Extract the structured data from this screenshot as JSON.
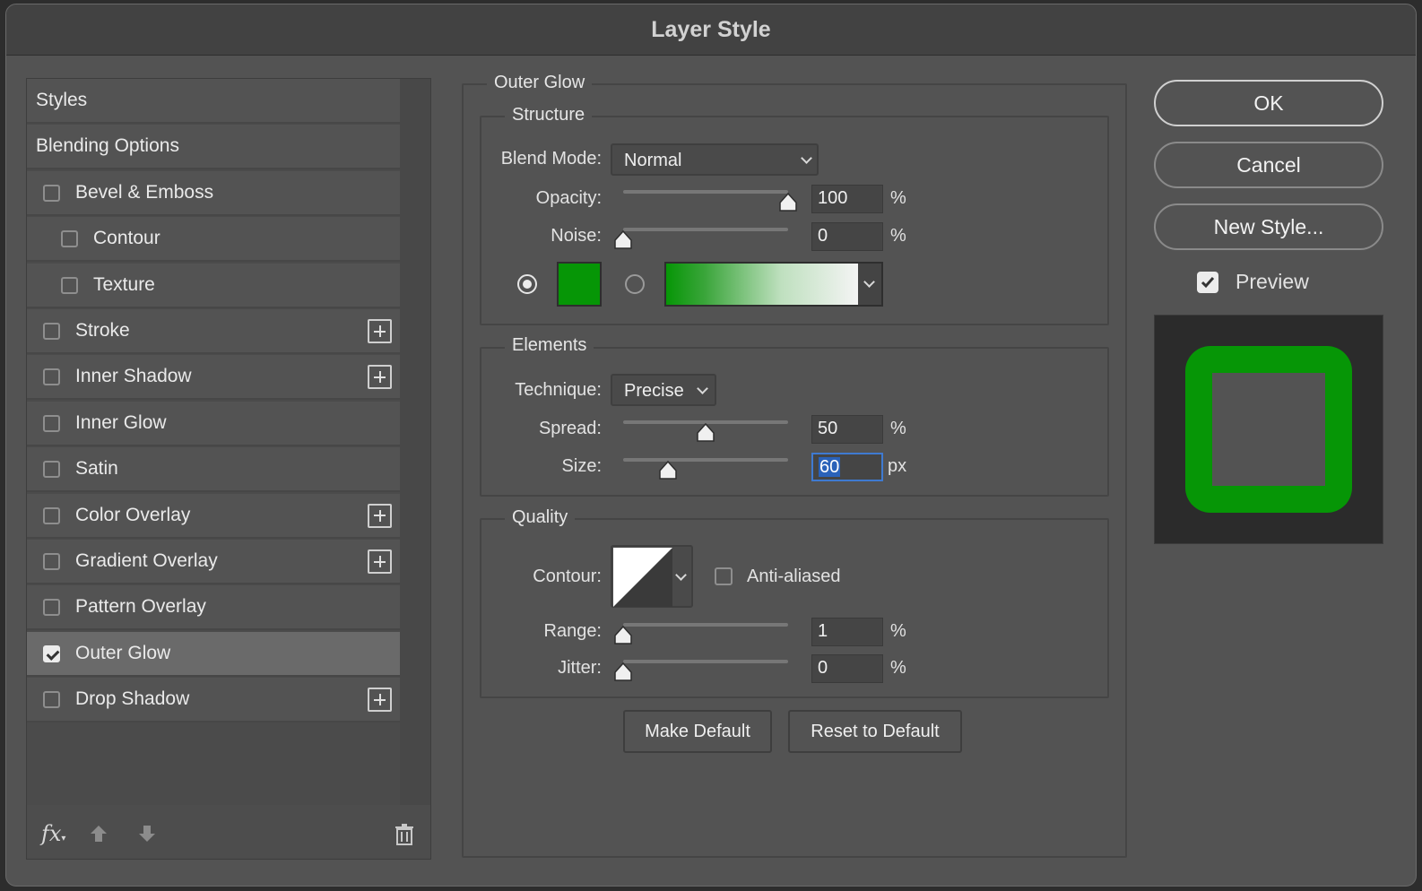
{
  "dialog": {
    "title": "Layer Style"
  },
  "style_list": {
    "items": [
      {
        "label": "Styles",
        "checkbox": false,
        "checked": false,
        "plus": false,
        "indent": 0,
        "selected": false
      },
      {
        "label": "Blending Options",
        "checkbox": false,
        "checked": false,
        "plus": false,
        "indent": 0,
        "selected": false
      },
      {
        "label": "Bevel & Emboss",
        "checkbox": true,
        "checked": false,
        "plus": false,
        "indent": 0,
        "selected": false
      },
      {
        "label": "Contour",
        "checkbox": true,
        "checked": false,
        "plus": false,
        "indent": 1,
        "selected": false
      },
      {
        "label": "Texture",
        "checkbox": true,
        "checked": false,
        "plus": false,
        "indent": 1,
        "selected": false
      },
      {
        "label": "Stroke",
        "checkbox": true,
        "checked": false,
        "plus": true,
        "indent": 0,
        "selected": false
      },
      {
        "label": "Inner Shadow",
        "checkbox": true,
        "checked": false,
        "plus": true,
        "indent": 0,
        "selected": false
      },
      {
        "label": "Inner Glow",
        "checkbox": true,
        "checked": false,
        "plus": false,
        "indent": 0,
        "selected": false
      },
      {
        "label": "Satin",
        "checkbox": true,
        "checked": false,
        "plus": false,
        "indent": 0,
        "selected": false
      },
      {
        "label": "Color Overlay",
        "checkbox": true,
        "checked": false,
        "plus": true,
        "indent": 0,
        "selected": false
      },
      {
        "label": "Gradient Overlay",
        "checkbox": true,
        "checked": false,
        "plus": true,
        "indent": 0,
        "selected": false
      },
      {
        "label": "Pattern Overlay",
        "checkbox": true,
        "checked": false,
        "plus": false,
        "indent": 0,
        "selected": false
      },
      {
        "label": "Outer Glow",
        "checkbox": true,
        "checked": true,
        "plus": false,
        "indent": 0,
        "selected": true
      },
      {
        "label": "Drop Shadow",
        "checkbox": true,
        "checked": false,
        "plus": true,
        "indent": 0,
        "selected": false
      }
    ],
    "footer": {
      "fx_label": "fx",
      "icons": [
        "fx-icon",
        "move-up-icon",
        "move-down-icon",
        "trash-icon"
      ]
    }
  },
  "outer_glow": {
    "title": "Outer Glow",
    "structure": {
      "title": "Structure",
      "blend_mode_label": "Blend Mode:",
      "blend_mode_value": "Normal",
      "opacity_label": "Opacity:",
      "opacity_value": "100",
      "opacity_unit": "%",
      "opacity_level": 1.0,
      "noise_label": "Noise:",
      "noise_value": "0",
      "noise_unit": "%",
      "noise_level": 0.0,
      "color": "#069606",
      "color_mode": "solid"
    },
    "elements": {
      "title": "Elements",
      "technique_label": "Technique:",
      "technique_value": "Precise",
      "spread_label": "Spread:",
      "spread_value": "50",
      "spread_unit": "%",
      "spread_level": 0.5,
      "size_label": "Size:",
      "size_value": "60",
      "size_unit": "px",
      "size_level": 0.27
    },
    "quality": {
      "title": "Quality",
      "contour_label": "Contour:",
      "anti_aliased_label": "Anti-aliased",
      "anti_aliased_checked": false,
      "range_label": "Range:",
      "range_value": "1",
      "range_unit": "%",
      "range_level": 0.0,
      "jitter_label": "Jitter:",
      "jitter_value": "0",
      "jitter_unit": "%",
      "jitter_level": 0.0
    },
    "make_default_label": "Make Default",
    "reset_default_label": "Reset to Default"
  },
  "actions": {
    "ok_label": "OK",
    "cancel_label": "Cancel",
    "new_style_label": "New Style...",
    "preview_label": "Preview",
    "preview_checked": true
  },
  "colors": {
    "glow": "#069606",
    "panel": "#535353",
    "focus": "#3f7ad1"
  }
}
